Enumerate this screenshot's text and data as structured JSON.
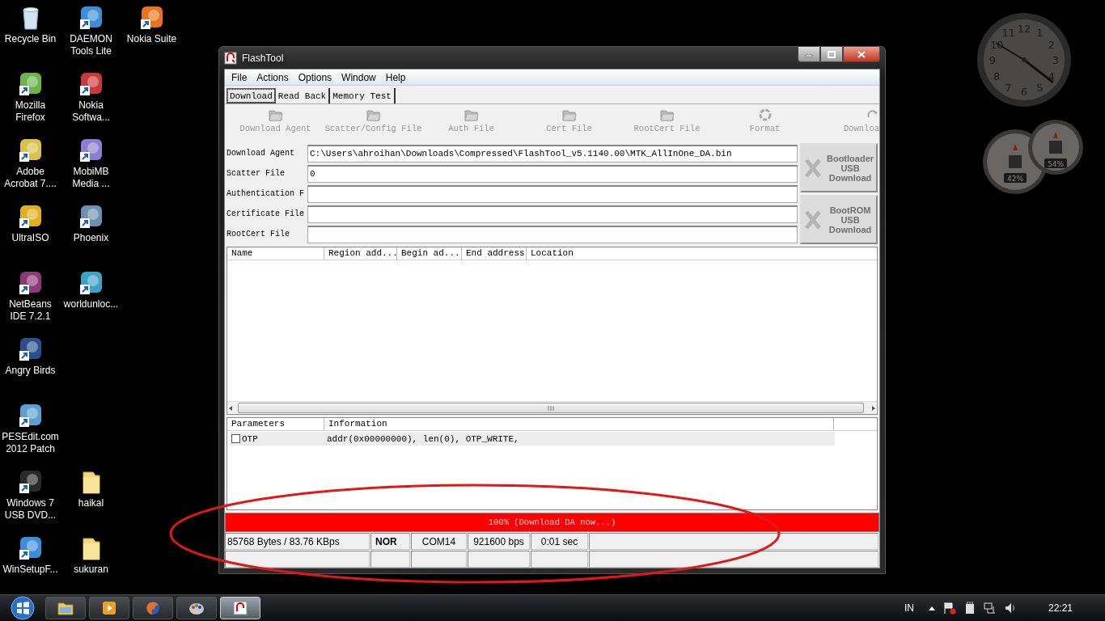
{
  "desktop": {
    "icons": [
      {
        "label": "Recycle Bin",
        "kind": "bin"
      },
      {
        "label": "DAEMON Tools Lite",
        "kind": "app"
      },
      {
        "label": "Nokia Suite",
        "kind": "app"
      },
      {
        "label": "Mozilla Firefox",
        "kind": "app"
      },
      {
        "label": "Nokia Softwa...",
        "kind": "app"
      },
      {
        "label": "Adobe Acrobat 7....",
        "kind": "app"
      },
      {
        "label": "MobiMB Media ...",
        "kind": "app"
      },
      {
        "label": "UltraISO",
        "kind": "app"
      },
      {
        "label": "Phoenix",
        "kind": "app"
      },
      {
        "label": "NetBeans IDE 7.2.1",
        "kind": "app"
      },
      {
        "label": "worldunloc...",
        "kind": "app"
      },
      {
        "label": "Angry Birds",
        "kind": "app"
      },
      {
        "label": "PESEdit.com 2012 Patch",
        "kind": "app"
      },
      {
        "label": "Windows 7 USB DVD...",
        "kind": "app"
      },
      {
        "label": "haikal",
        "kind": "folder"
      },
      {
        "label": "WinSetupF...",
        "kind": "app"
      },
      {
        "label": "sukuran",
        "kind": "folder"
      }
    ]
  },
  "gadgets": {
    "clock": {
      "numerals": [
        "12",
        "11",
        "1",
        "10",
        "2",
        "9",
        "3",
        "8",
        "4",
        "7",
        "5",
        "6"
      ]
    },
    "meters": [
      {
        "reading": "42%"
      },
      {
        "reading": "54%"
      }
    ]
  },
  "window": {
    "title": "FlashTool",
    "menu": [
      "File",
      "Actions",
      "Options",
      "Window",
      "Help"
    ],
    "tabs": [
      {
        "label": "Download",
        "selected": true
      },
      {
        "label": "Read Back",
        "selected": false
      },
      {
        "label": "Memory Test",
        "selected": false
      }
    ],
    "toolbar": [
      {
        "label": "Download Agent",
        "kind": "folder",
        "disabled": true
      },
      {
        "label": "Scatter/Config File",
        "kind": "folder",
        "disabled": true
      },
      {
        "label": "Auth File",
        "kind": "folder",
        "disabled": true
      },
      {
        "label": "Cert File",
        "kind": "folder",
        "disabled": true
      },
      {
        "label": "RootCert File",
        "kind": "folder",
        "disabled": true
      },
      {
        "label": "Format",
        "kind": "format",
        "disabled": true
      },
      {
        "label": "Downloa",
        "kind": "download",
        "disabled": true
      }
    ],
    "fields": [
      {
        "label": "Download Agent",
        "value": "C:\\Users\\ahroihan\\Downloads\\Compressed\\FlashTool_v5.1140.00\\MTK_AllInOne_DA.bin"
      },
      {
        "label": "Scatter File",
        "value": "0"
      },
      {
        "label": "Authentication F"
      },
      {
        "label": "Certificate File"
      },
      {
        "label": "RootCert File"
      }
    ],
    "side_buttons": [
      {
        "lines": [
          "Bootloader",
          "USB",
          "Download"
        ],
        "disabled": true
      },
      {
        "lines": [
          "BootROM",
          "USB",
          "Download"
        ],
        "disabled": true
      }
    ],
    "table": {
      "columns": [
        "Name",
        "Region add...",
        "Begin ad...",
        "End address",
        "Location"
      ]
    },
    "parameters": {
      "columns": [
        "Parameters",
        "Information"
      ],
      "rows": [
        {
          "name": "OTP",
          "checked": false,
          "information": "addr(0x00000000), len(0), OTP_WRITE,"
        }
      ]
    },
    "progress": {
      "level": 1,
      "text": "100% (Download DA now...)"
    },
    "status_bar": [
      {
        "text": "85768 Bytes / 83.76 KBps",
        "bold": false
      },
      {
        "text": "NOR",
        "bold": true
      },
      {
        "text": "COM14",
        "bold": false
      },
      {
        "text": "921600 bps",
        "bold": false
      },
      {
        "text": "0:01 sec",
        "bold": false
      }
    ]
  },
  "taskbar": {
    "buttons": [
      {
        "kind": "folder",
        "selected": false
      },
      {
        "kind": "player",
        "selected": false
      },
      {
        "kind": "globe",
        "selected": false
      },
      {
        "kind": "palette",
        "selected": false
      },
      {
        "kind": "flash",
        "selected": true
      }
    ],
    "tray": {
      "language": "IN",
      "time": "22:21"
    }
  }
}
